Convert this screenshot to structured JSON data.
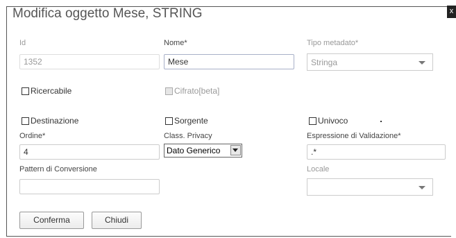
{
  "dialog": {
    "title": "Modifica oggetto Mese, STRING",
    "close_label": "x"
  },
  "fields": {
    "id": {
      "label": "Id",
      "value": "1352"
    },
    "nome": {
      "label": "Nome*",
      "value": "Mese"
    },
    "tipo_metadato": {
      "label": "Tipo metadato*",
      "value": "Stringa"
    },
    "ricercabile": {
      "label": "Ricercabile",
      "checked": false
    },
    "cifrato": {
      "label": "Cifrato[beta]",
      "checked": false,
      "disabled": true
    },
    "destinazione": {
      "label": "Destinazione",
      "checked": false
    },
    "sorgente": {
      "label": "Sorgente",
      "checked": false
    },
    "univoco": {
      "label": "Univoco",
      "checked": false
    },
    "ordine": {
      "label": "Ordine*",
      "value": "4"
    },
    "class_privacy": {
      "label": "Class. Privacy",
      "value": "Dato Generico"
    },
    "espressione": {
      "label": "Espressione di Validazione*",
      "value": ".*"
    },
    "pattern": {
      "label": "Pattern di Conversione",
      "value": ""
    },
    "locale": {
      "label": "Locale",
      "value": ""
    }
  },
  "buttons": {
    "confirm": "Conferma",
    "close": "Chiudi"
  }
}
